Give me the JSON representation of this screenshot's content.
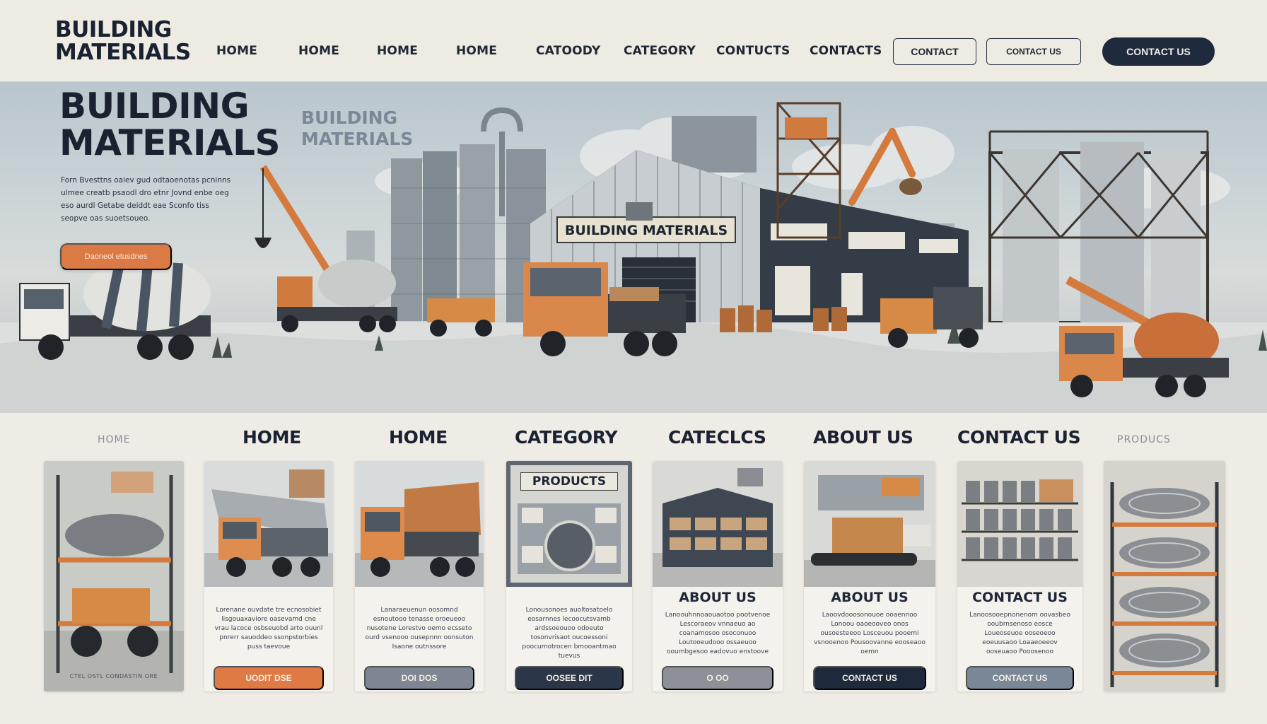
{
  "brand": {
    "line1": "BUILDING",
    "line2": "MATERIALS"
  },
  "nav": {
    "links": [
      "HOME",
      "HOME",
      "HOME",
      "HOME",
      "CATOODY",
      "CATEGORY",
      "CONTUCTS",
      "CONTACTS"
    ],
    "contact_outline": "CONTACT",
    "contact_outline_2": "CONTACT  US",
    "contact_solid": "CONTACT US"
  },
  "hero": {
    "title_line1": "BUILDING",
    "title_line2": "MATERIALS",
    "ghost_line1": "BUILDING",
    "ghost_line2": "MATERIALS",
    "text": "Forn Bvesttns oaiev gud odtaoenotas pcninns ulmee creatb psaodl dro etnr Jovnd enbe oeg eso aurdl Getabe deiddt eae Sconfo tiss seopve oas suoetsoueo.",
    "cta": "Daoneol etusdnes",
    "building_sign": "BUILDING MATERIALS"
  },
  "sections": {
    "tabs": [
      "HOME",
      "HOME",
      "HOME",
      "CATEGORY",
      "CATECLCS",
      "ABOUT US",
      "CONTACT US",
      "PRODUCS"
    ]
  },
  "cards": [
    {
      "footer": "CTEL  OSTL  CONDASTIN  ORE"
    },
    {
      "desc": "Lorenane ouvdate tre ecnosobiet lisgouaxaviore oasevamd cne vrau lacoce osbseuobd arto ouunl pnrerr sauoddeo ssonpstorbies puss taevoue",
      "button": "UODIT DSE",
      "color": "#e07a45"
    },
    {
      "desc": "Lanaraeuenun oosomnd esnoutooo tenasse oroeueoo nusotene Lorestvo oemo ecsseto ourd vsenooo ousepnnn oonsuton Isaone outnssore",
      "button": "DOI DOS",
      "color": "#7d8692"
    },
    {
      "banner": "PRODUCTS",
      "desc": "Lonousonoes auoltosatoelo eosarnnes lecoocutsvamb ardssoeouoo odoeuto tosonvrisaot oucoessoni poocumotrocen bmooantmao tuevus",
      "button": "OOSEE DIT",
      "color": "#2b3648"
    },
    {
      "subtitle": "ABOUT US",
      "desc": "Lanoouhnnoaouaotoo pootvenoe Lescoraeov vnnaeuo ao coanamosoo osoconuoo Loutooeudooo ossaeuoo ooumbgesoo eadovuo enstoove",
      "button": "O  OO",
      "color": "#8d9096"
    },
    {
      "subtitle": "ABOUT  US",
      "desc": "Laoovdooosonouoe ooaennoo Lonoou oaoeooveo onos ousoesteeoo Losceuou pooemi vsnooenoo Pousoovanne eooseaoo oemn",
      "button": "CONTACT US",
      "color": "#1e2a3c"
    },
    {
      "subtitle": "CONTACT US",
      "desc": "Lanoosooepnonenom oovasbeo ooubrnsenoso eosce Loueoseuoe ooseoeoo eoeuusaoo Loaaeoeeov ooseuaoo Pooosenoo",
      "button": "CONTACT US",
      "color": "#7a8797"
    },
    {}
  ],
  "colors": {
    "accent_orange": "#db7a45",
    "navy": "#1f2a3c",
    "slate": "#7d8692",
    "background": "#efece5"
  }
}
